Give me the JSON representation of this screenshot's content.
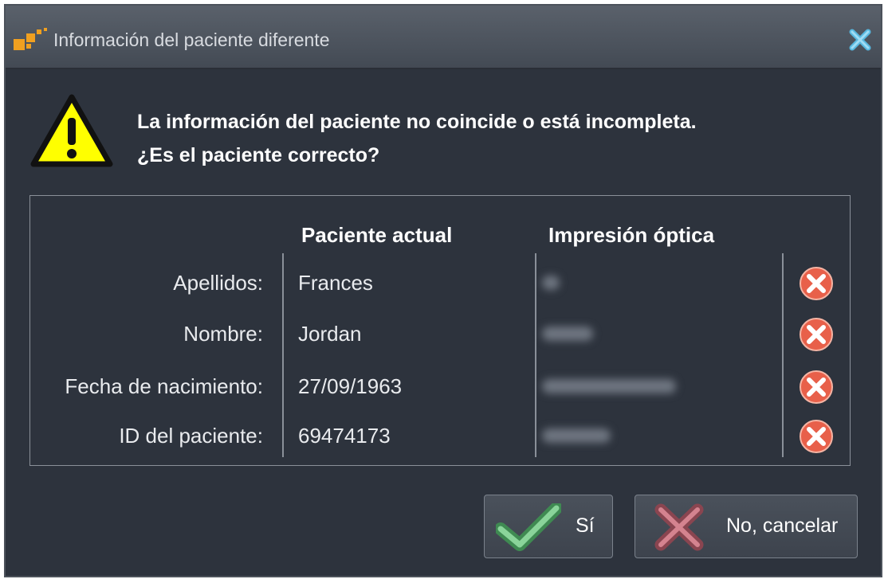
{
  "window": {
    "title": "Información del paciente diferente",
    "colors": {
      "background": "#2d333d",
      "titlebar": "#4c535d",
      "accent": "#f0a020"
    }
  },
  "message": {
    "line1": "La información del paciente no coincide o está incompleta.",
    "line2": "¿Es el paciente correcto?"
  },
  "table": {
    "headers": {
      "current": "Paciente actual",
      "optical": "Impresión óptica"
    },
    "rows": [
      {
        "label": "Apellidos:",
        "current": "Frances",
        "status_icon": "mismatch-x-icon"
      },
      {
        "label": "Nombre:",
        "current": "Jordan",
        "status_icon": "mismatch-x-icon"
      },
      {
        "label": "Fecha de nacimiento:",
        "current": "27/09/1963",
        "status_icon": "mismatch-x-icon"
      },
      {
        "label": "ID del paciente:",
        "current": "69474173",
        "status_icon": "mismatch-x-icon"
      }
    ]
  },
  "buttons": {
    "yes": {
      "label": "Sí",
      "icon": "checkmark-icon"
    },
    "no": {
      "label": "No, cancelar",
      "icon": "cross-icon"
    }
  }
}
